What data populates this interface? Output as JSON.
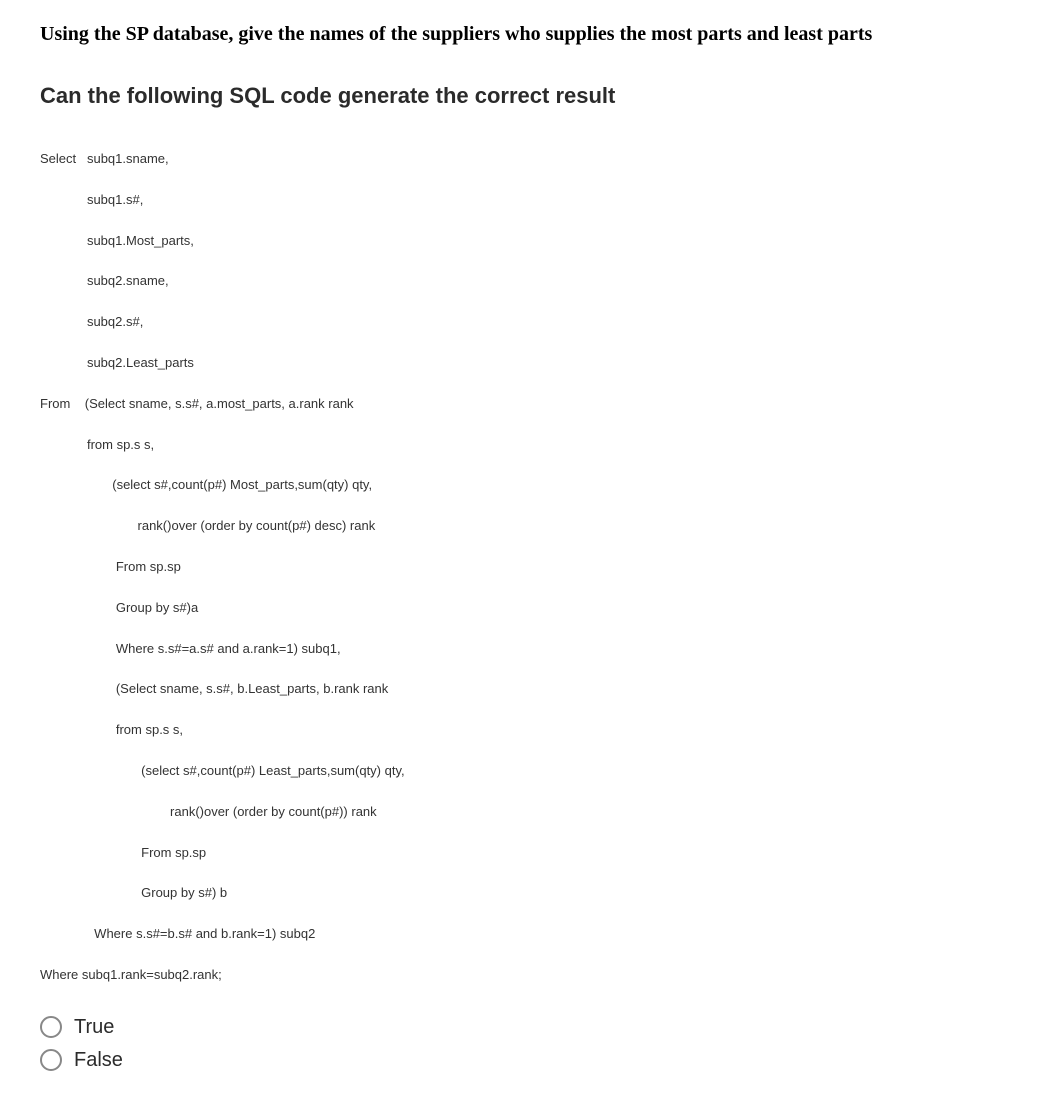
{
  "title": "Using the SP database, give the names of the suppliers who supplies the most parts and least parts",
  "subtitle": "Can the following SQL code generate the correct result",
  "code_lines": [
    "Select   subq1.sname,",
    "             subq1.s#,",
    "             subq1.Most_parts,",
    "             subq2.sname,",
    "             subq2.s#,",
    "             subq2.Least_parts",
    "From    (Select sname, s.s#, a.most_parts, a.rank rank",
    "             from sp.s s,",
    "                    (select s#,count(p#) Most_parts,sum(qty) qty,",
    "                           rank()over (order by count(p#) desc) rank",
    "                     From sp.sp",
    "                     Group by s#)a",
    "                     Where s.s#=a.s# and a.rank=1) subq1,",
    "                     (Select sname, s.s#, b.Least_parts, b.rank rank",
    "                     from sp.s s,",
    "                            (select s#,count(p#) Least_parts,sum(qty) qty,",
    "                                    rank()over (order by count(p#)) rank",
    "                            From sp.sp",
    "                            Group by s#) b",
    "               Where s.s#=b.s# and b.rank=1) subq2",
    "Where subq1.rank=subq2.rank;"
  ],
  "options": {
    "true_label": "True",
    "false_label": "False"
  }
}
